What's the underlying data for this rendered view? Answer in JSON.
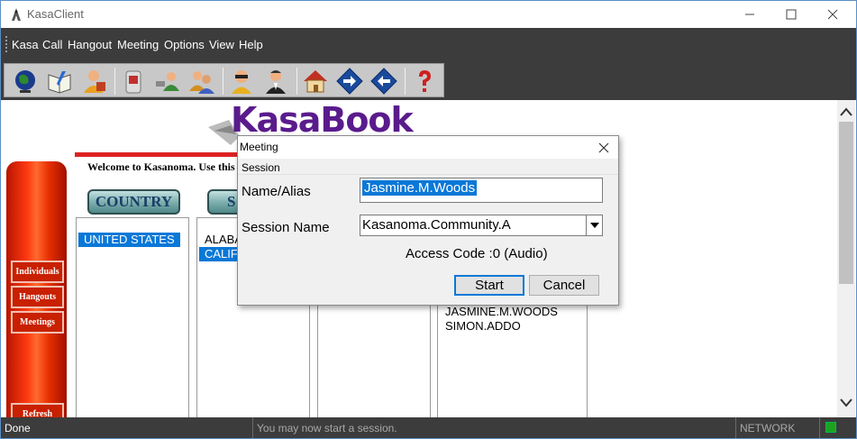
{
  "window": {
    "title": "KasaClient"
  },
  "menu": {
    "items": [
      "Kasa",
      "Call",
      "Hangout",
      "Meeting",
      "Options",
      "View",
      "Help"
    ]
  },
  "toolbar": {
    "icons": [
      "globe-icon",
      "book-icon",
      "user-profile-icon",
      "phone-icon",
      "contact-icon",
      "group-icon",
      "sunglasses-person-icon",
      "agent-icon",
      "home-icon",
      "arrow-right-icon",
      "arrow-left-icon",
      "help-icon"
    ]
  },
  "content": {
    "logo_text": "KasaBook",
    "welcome": "Welcome to Kasanoma. Use this",
    "sidebar": {
      "individuals": "Individuals",
      "hangouts": "Hangouts",
      "meetings": "Meetings",
      "refresh": "Refresh"
    },
    "country_header": "COUNTRY",
    "state_header_partial": "S",
    "country_list": [
      "UNITED STATES"
    ],
    "state_list": [
      "ALABA",
      "CALIF"
    ],
    "member_list": [
      "JASMINE.M.WOODS",
      "SIMON.ADDO"
    ]
  },
  "status": {
    "left": "Done",
    "middle": "You may now start a session.",
    "right": "NETWORK"
  },
  "dialog": {
    "title": "Meeting",
    "group": "Session",
    "name_label": "Name/Alias",
    "name_value": "Jasmine.M.Woods",
    "session_label": "Session Name",
    "session_value": "Kasanoma.Community.A",
    "access_code": "Access Code :0 (Audio)",
    "start_label": "Start",
    "cancel_label": "Cancel"
  },
  "colors": {
    "accent": "#0a78d7",
    "status_ok": "#1ea11e",
    "pillar": "#ff3a10"
  }
}
